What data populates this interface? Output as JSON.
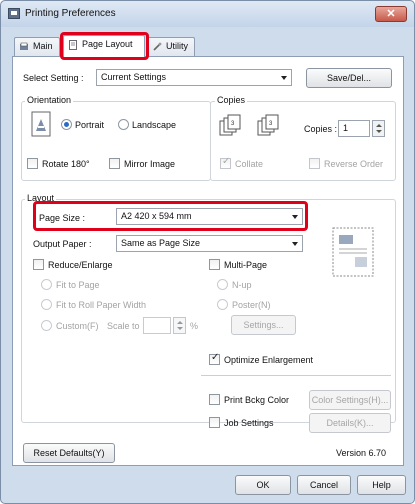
{
  "window": {
    "title": "Printing Preferences",
    "close": "✕"
  },
  "tabs": [
    {
      "label": "Main"
    },
    {
      "label": "Page Layout"
    },
    {
      "label": "Utility"
    }
  ],
  "select_setting": {
    "label": "Select Setting :",
    "value": "Current Settings",
    "save_button": "Save/Del..."
  },
  "orientation": {
    "group_label": "Orientation",
    "portrait": "Portrait",
    "landscape": "Landscape",
    "rotate": "Rotate 180°",
    "mirror": "Mirror Image"
  },
  "copies": {
    "group_label": "Copies",
    "copies_label": "Copies :",
    "copies_value": "1",
    "collate": "Collate",
    "reverse_order": "Reverse Order"
  },
  "layout": {
    "group_label": "Layout",
    "page_size_label": "Page Size :",
    "page_size_value": "A2 420 x 594 mm",
    "output_paper_label": "Output Paper :",
    "output_paper_value": "Same as Page Size",
    "reduce_enlarge": "Reduce/Enlarge",
    "fit_to_page": "Fit to Page",
    "fit_to_roll": "Fit to Roll Paper Width",
    "custom": "Custom(F)",
    "scale_to": "Scale to",
    "scale_unit": "%",
    "multi_page": "Multi-Page",
    "n_up": "N-up",
    "poster": "Poster(N)",
    "settings_button": "Settings...",
    "optimize": "Optimize Enlargement",
    "print_bckg": "Print Bckg Color",
    "color_settings_button": "Color Settings(H)...",
    "job_settings": "Job Settings",
    "details_button": "Details(K)..."
  },
  "footer": {
    "reset_button": "Reset Defaults(Y)",
    "version": "Version 6.70"
  },
  "dialog_buttons": {
    "ok": "OK",
    "cancel": "Cancel",
    "help": "Help"
  }
}
